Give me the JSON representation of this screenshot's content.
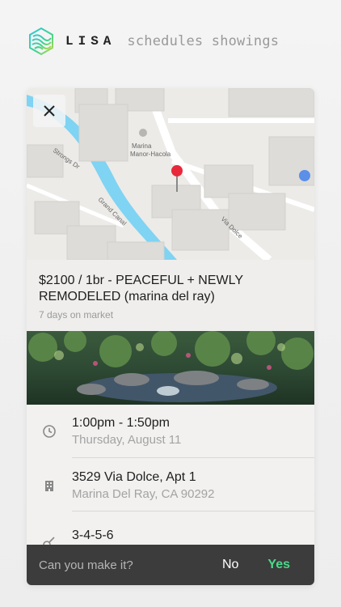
{
  "header": {
    "brand": "LISA",
    "tagline": "schedules showings"
  },
  "map": {
    "labels": {
      "poi": "Marina Manor-Hacola",
      "street1": "Strongs Dr",
      "street2": "Grand Canal",
      "street3": "Via Dolce"
    }
  },
  "listing": {
    "title": "$2100 / 1br - PEACEFUL + NEWLY REMODELED (marina del ray)",
    "days_on_market": "7 days on market"
  },
  "details": {
    "time": {
      "icon": "clock-icon",
      "range": "1:00pm - 1:50pm",
      "date": "Thursday, August 11"
    },
    "address": {
      "icon": "building-icon",
      "street": "3529 Via Dolce, Apt 1",
      "city": "Marina Del Ray, CA 90292"
    },
    "code": {
      "icon": "key-icon",
      "value": "3-4-5-6"
    }
  },
  "prompt": {
    "question": "Can you make it?",
    "no_label": "No",
    "yes_label": "Yes"
  },
  "colors": {
    "accent_yes": "#4cd98a",
    "bar_background": "#3c3c3c",
    "canal": "#7fd3f3"
  }
}
